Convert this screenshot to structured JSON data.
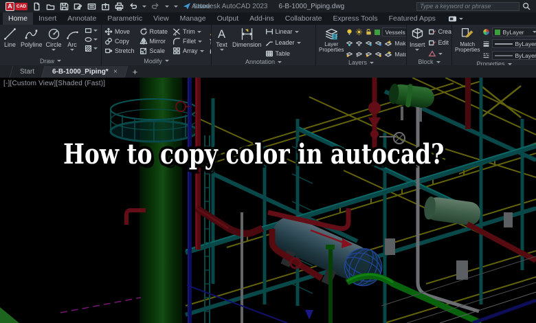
{
  "logo": {
    "letter": "A",
    "text": "CAD"
  },
  "titlebar": {
    "app_title": "Autodesk AutoCAD 2023",
    "doc_title": "6-B-1000_Piping.dwg",
    "share_label": "Share",
    "search_placeholder": "Type a keyword or phrase"
  },
  "glyphs": {
    "close": "×",
    "plus": "+",
    "text_tool": "A"
  },
  "ribbon": {
    "tabs": [
      {
        "label": "Home"
      },
      {
        "label": "Insert"
      },
      {
        "label": "Annotate"
      },
      {
        "label": "Parametric"
      },
      {
        "label": "View"
      },
      {
        "label": "Manage"
      },
      {
        "label": "Output"
      },
      {
        "label": "Add-ins"
      },
      {
        "label": "Collaborate"
      },
      {
        "label": "Express Tools"
      },
      {
        "label": "Featured Apps"
      }
    ],
    "panels": {
      "draw": {
        "label": "Draw",
        "line": "Line",
        "polyline": "Polyline",
        "circle": "Circle",
        "arc": "Arc"
      },
      "modify": {
        "label": "Modify",
        "move": "Move",
        "rotate": "Rotate",
        "trim": "Trim",
        "copy": "Copy",
        "mirror": "Mirror",
        "fillet": "Fillet",
        "stretch": "Stretch",
        "scale": "Scale",
        "array": "Array"
      },
      "annotation": {
        "label": "Annotation",
        "text": "Text",
        "dimension": "Dimension",
        "linear": "Linear",
        "leader": "Leader",
        "table": "Table"
      },
      "layers": {
        "label": "Layers",
        "layer_properties": "Layer Properties",
        "current_layer": "Vessels",
        "make_current": "Make Current",
        "match_layer": "Match Layer"
      },
      "block": {
        "label": "Block",
        "insert": "Insert",
        "create": "Create",
        "edit": "Edit"
      },
      "properties": {
        "label": "Properties",
        "match_properties": "Match Properties",
        "color": "ByLayer",
        "lineweight": "ByLayer",
        "linetype": "ByLayer"
      }
    }
  },
  "filetabs": {
    "start": "Start",
    "document": "6-B-1000_Piping*"
  },
  "viewport": {
    "controls": "[-][Custom View][Shaded (Fast)]",
    "overlay_title": "How to copy color in autocad?"
  },
  "colors": {
    "accent_red": "#c21d2c",
    "vessel_green": "#1b6e1b",
    "frame_teal": "#0d6868",
    "steel_yellow": "#8f8f12",
    "pipe_red": "#8e1522",
    "tank_steel_blue": "#4d7586",
    "layer_green": "#3f9e3f"
  }
}
